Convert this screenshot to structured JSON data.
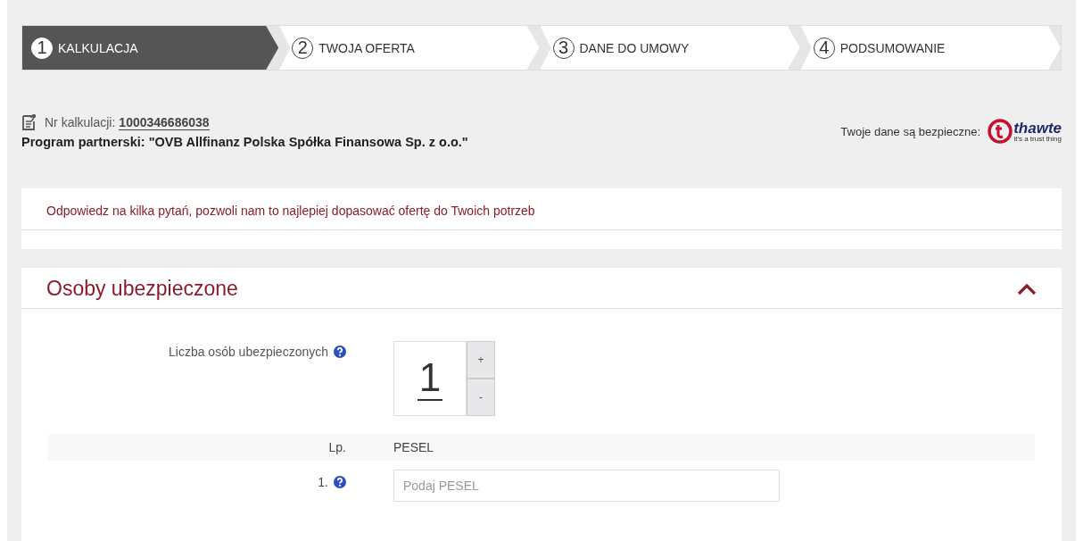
{
  "steps": [
    {
      "number": "1",
      "label": "KALKULACJA",
      "selected": true
    },
    {
      "number": "2",
      "label": "TWOJA OFERTA",
      "selected": false
    },
    {
      "number": "3",
      "label": "DANE DO UMOWY",
      "selected": false
    },
    {
      "number": "4",
      "label": "PODSUMOWANIE",
      "selected": false
    }
  ],
  "calculation": {
    "label": "Nr kalkulacji:",
    "number": "1000346686038"
  },
  "partner_program": "Program partnerski: \"OVB Allfinanz Polska Spółka Finansowa Sp. z o.o.\"",
  "security": {
    "label": "Twoje dane są bezpieczne:",
    "logo_text": "thawte",
    "logo_tagline": "it's a trust thing"
  },
  "notice": "Odpowiedz na kilka pytań, pozwoli nam to najlepiej dopasować ofertę do Twoich potrzeb",
  "section": {
    "title": "Osoby ubezpieczone",
    "expanded": true,
    "count_label": "Liczba osób ubezpieczonych",
    "count_value": "1",
    "increment": "+",
    "decrement": "-",
    "table": {
      "columns": [
        "Lp.",
        "PESEL"
      ],
      "rows": [
        {
          "index": "1.",
          "pesel_placeholder": "Podaj PESEL"
        }
      ]
    }
  }
}
